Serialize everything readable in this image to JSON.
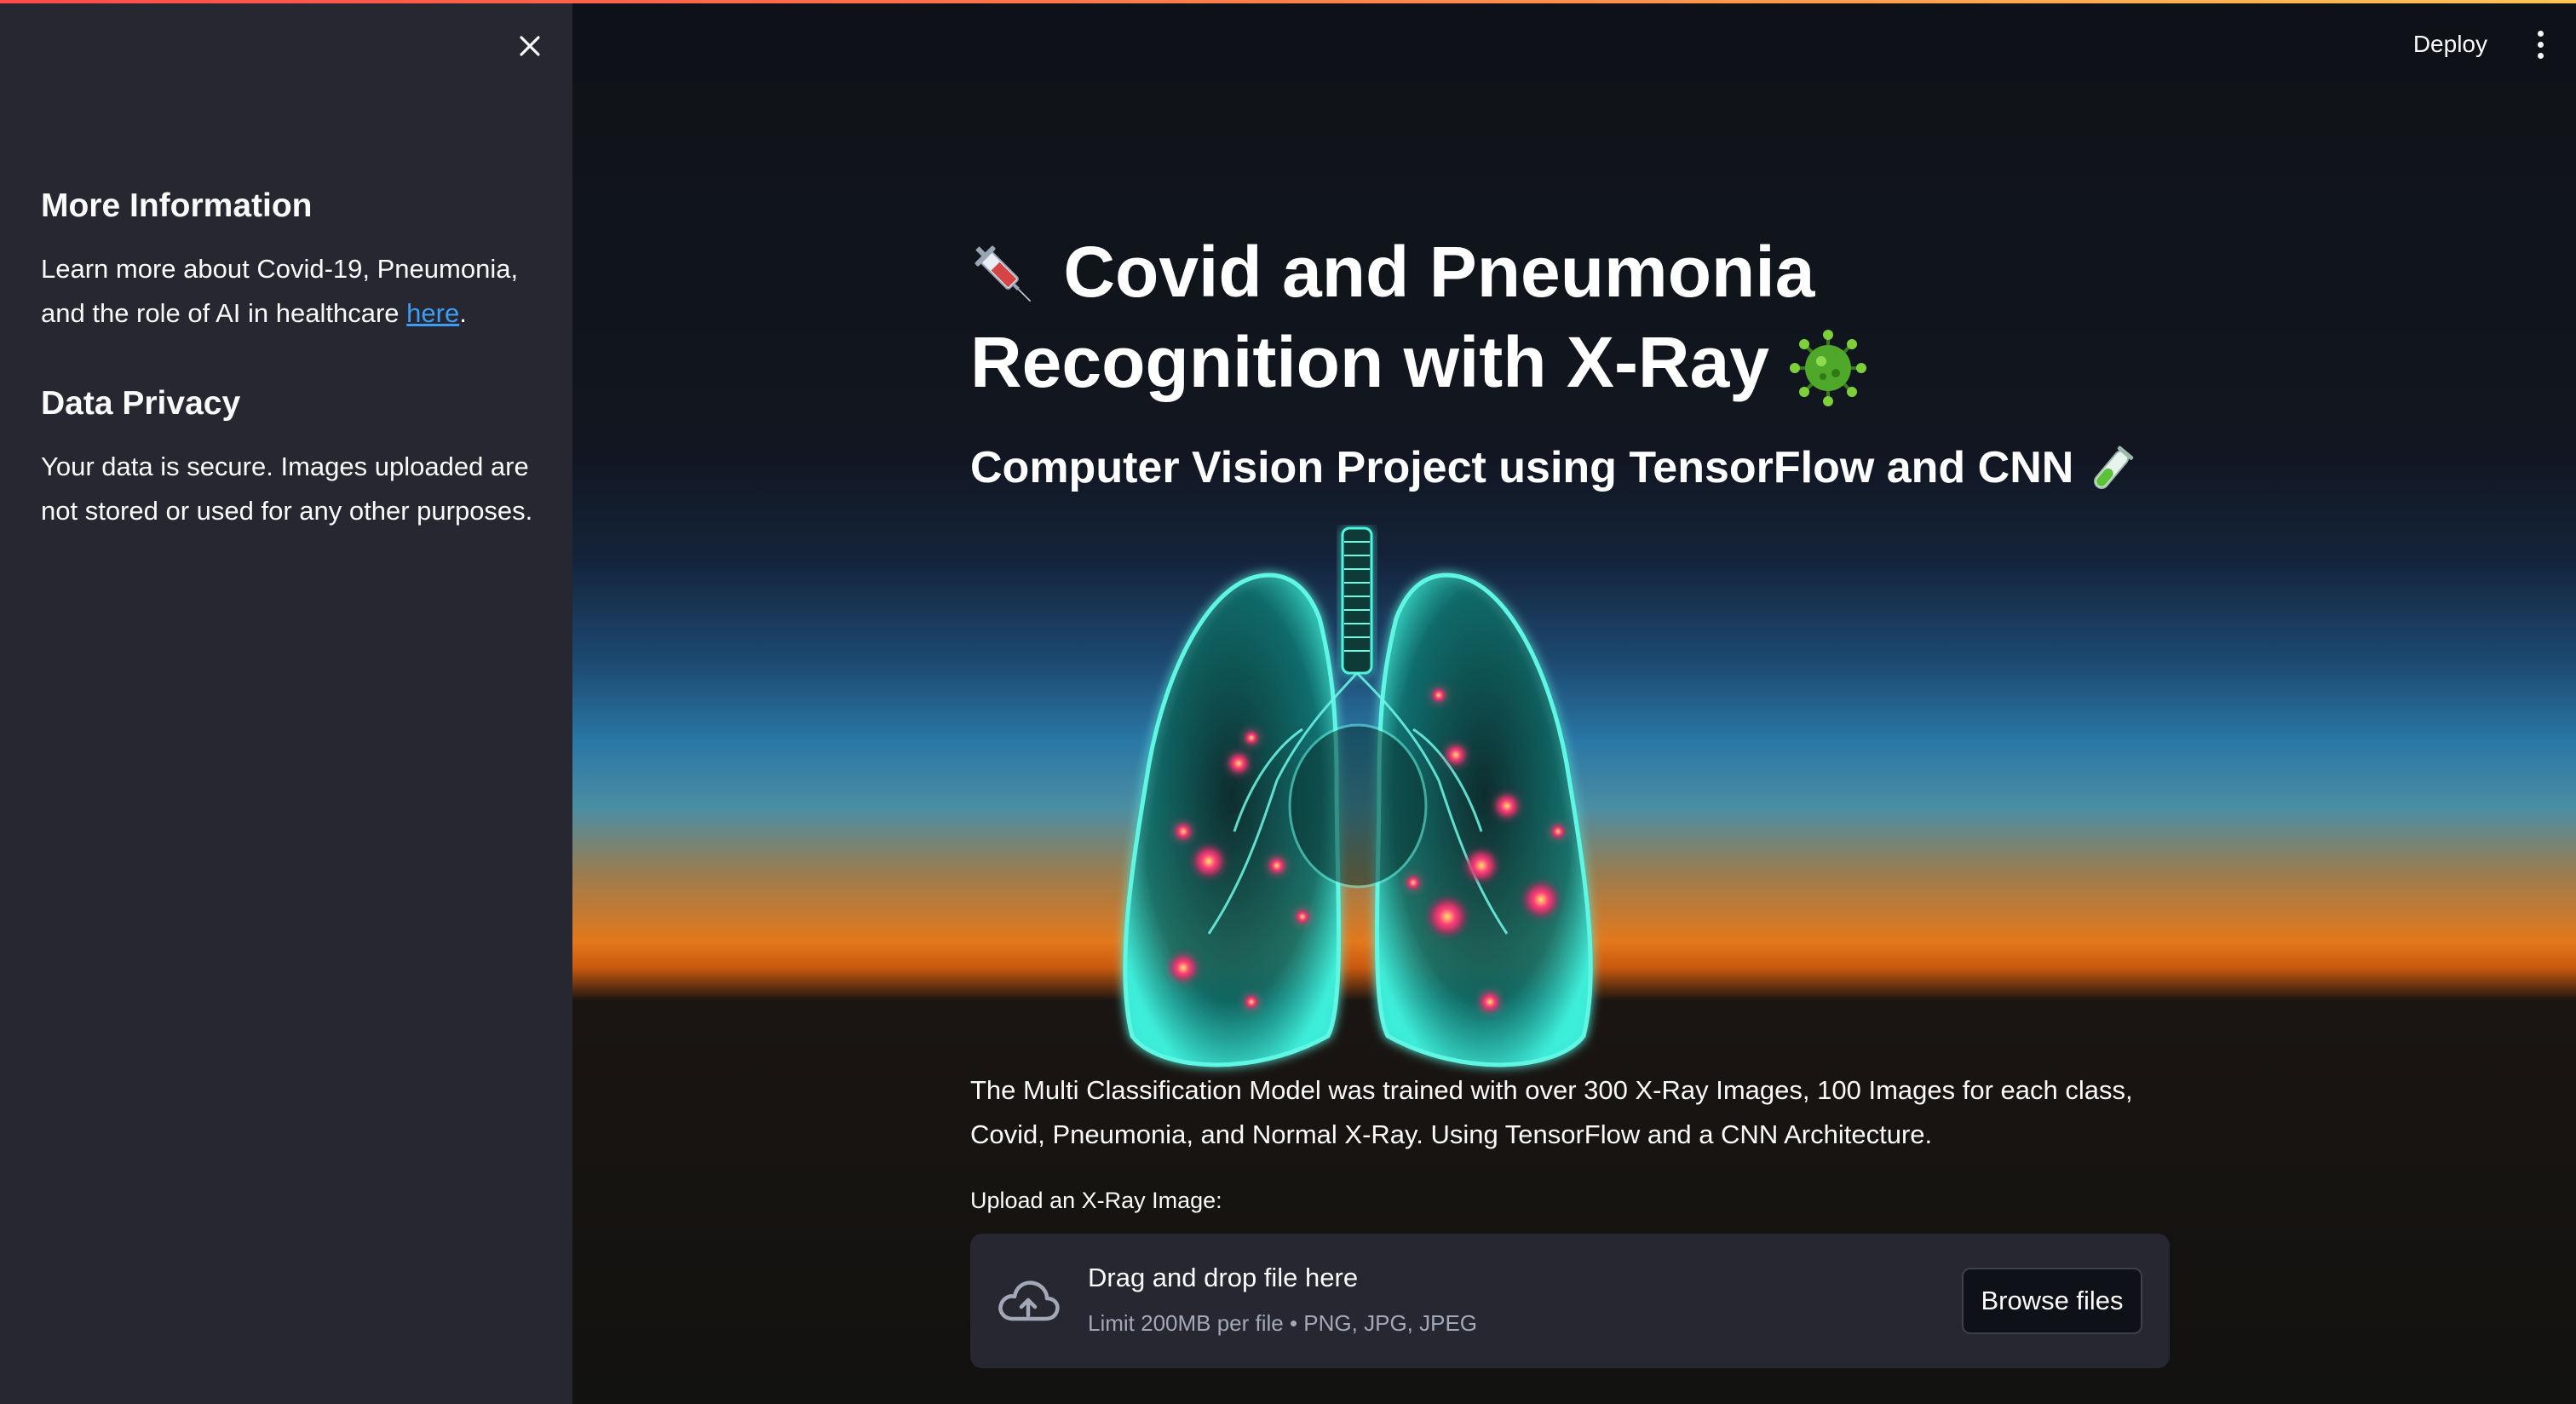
{
  "sidebar": {
    "more_info_heading": "More Information",
    "more_info_text_before": "Learn more about Covid-19, Pneumonia, and the role of AI in healthcare ",
    "more_info_link": "here",
    "more_info_text_after": ".",
    "privacy_heading": "Data Privacy",
    "privacy_text": "Your data is secure. Images uploaded are not stored or used for any other purposes."
  },
  "header": {
    "deploy_label": "Deploy"
  },
  "main": {
    "title_line1": "Covid and Pneumonia",
    "title_line2": "Recognition with X-Ray",
    "subtitle": "Computer Vision Project using TensorFlow and CNN",
    "description": "The Multi Classification Model was trained with over 300 X-Ray Images, 100 Images for each class, Covid, Pneumonia, and Normal X-Ray. Using TensorFlow and a CNN Architecture.",
    "upload_label": "Upload an X-Ray Image:",
    "dropzone_title": "Drag and drop file here",
    "dropzone_subtitle": "Limit 200MB per file • PNG, JPG, JPEG",
    "browse_label": "Browse files"
  },
  "icons": {
    "close": "close-icon",
    "menu": "kebab-menu-icon",
    "syringe": "syringe-emoji",
    "virus": "virus-emoji",
    "test_tube": "test-tube-emoji",
    "upload": "cloud-upload-icon"
  },
  "colors": {
    "accent_gradient_start": "#ff4b4b",
    "accent_gradient_end": "#fdc454",
    "sidebar_bg": "#262730",
    "app_bg": "#0e1117",
    "link": "#3d9df3"
  }
}
